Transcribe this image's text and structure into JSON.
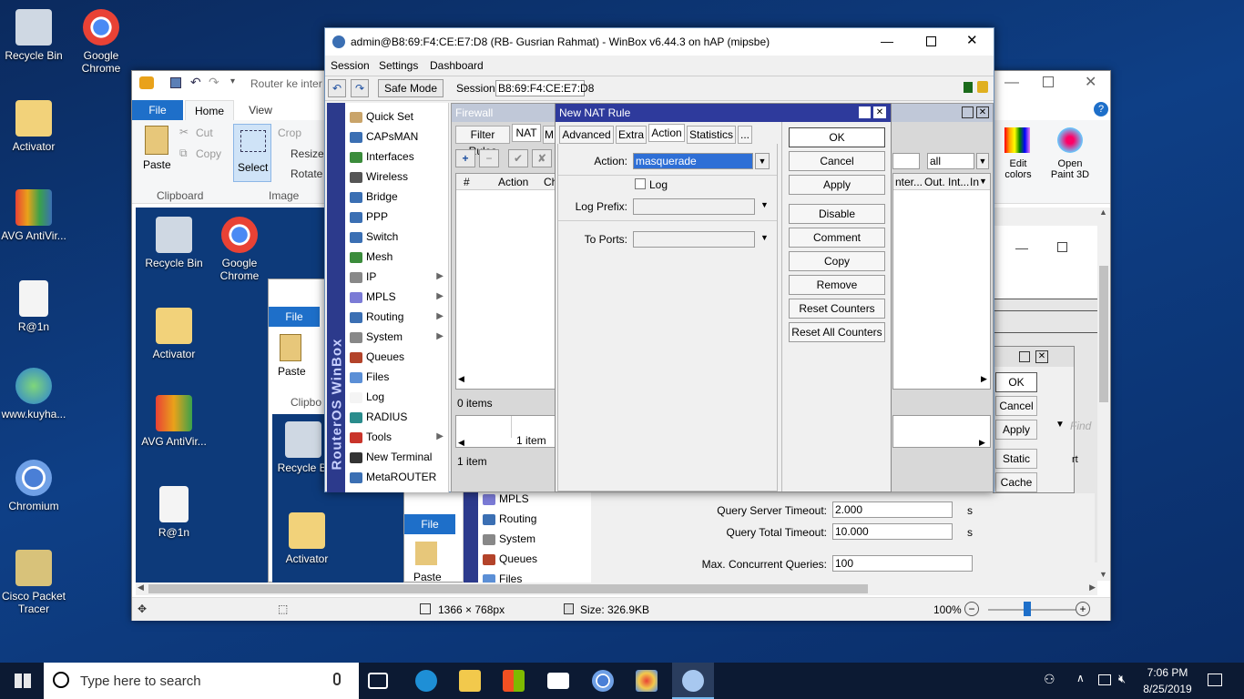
{
  "desktop": {
    "icons": [
      {
        "label": "Recycle Bin",
        "color": "#cfd8e3"
      },
      {
        "label": "Google Chrome",
        "color": "#e94235"
      },
      {
        "label": "Activator",
        "color": "#f2d27a"
      },
      {
        "label": "AVG AntiVir...",
        "color": "#e9a21a"
      },
      {
        "label": "R@1n",
        "color": "#f4f4f4"
      },
      {
        "label": "www.kuyha...",
        "color": "#3aa14b"
      },
      {
        "label": "Chromium",
        "color": "#4a7fd6"
      },
      {
        "label": "Cisco Packet Tracer",
        "color": "#d8c27a"
      }
    ]
  },
  "paint": {
    "title": "Router ke inter",
    "tabs": {
      "file": "File",
      "home": "Home",
      "view": "View"
    },
    "clipboard": {
      "paste": "Paste",
      "cut": "Cut",
      "copy": "Copy",
      "group": "Clipboard"
    },
    "image": {
      "select": "Select",
      "crop": "Crop",
      "resize": "Resize",
      "rotate": "Rotate",
      "group": "Image"
    },
    "right": {
      "edit_colors": "Edit colors",
      "open_paint3d": "Open Paint 3D"
    },
    "status": {
      "dimensions": "1366 × 768px",
      "size": "Size: 326.9KB",
      "zoom": "100%"
    }
  },
  "nested": {
    "recycle": "Recycle Bin",
    "chrome": "Google Chrome",
    "activator": "Activator",
    "avg": "AVG AntiVir...",
    "r1n": "R@1n",
    "file": "File",
    "paste": "Paste",
    "clipbo": "Clipbo",
    "recycle2": "Recycle Bi",
    "activator2": "Activator",
    "file2": "File",
    "paste2": "Paste"
  },
  "winbox": {
    "title": "admin@B8:69:F4:CE:E7:D8 (RB- Gusrian Rahmat) - WinBox v6.44.3 on hAP (mipsbe)",
    "menu": [
      "Session",
      "Settings",
      "Dashboard"
    ],
    "safe_mode": "Safe Mode",
    "session_label": "Session:",
    "session_value": "B8:69:F4:CE:E7:D8",
    "side_brand": "RouterOS WinBox",
    "side_items": [
      {
        "label": "Quick Set",
        "color": "#c9a46a",
        "arrow": ""
      },
      {
        "label": "CAPsMAN",
        "color": "#3b6fb3",
        "arrow": ""
      },
      {
        "label": "Interfaces",
        "color": "#3b8c3b",
        "arrow": ""
      },
      {
        "label": "Wireless",
        "color": "#555555",
        "arrow": ""
      },
      {
        "label": "Bridge",
        "color": "#3b6fb3",
        "arrow": ""
      },
      {
        "label": "PPP",
        "color": "#3b6fb3",
        "arrow": ""
      },
      {
        "label": "Switch",
        "color": "#3b6fb3",
        "arrow": ""
      },
      {
        "label": "Mesh",
        "color": "#3b8c3b",
        "arrow": ""
      },
      {
        "label": "IP",
        "color": "#888888",
        "arrow": "▶"
      },
      {
        "label": "MPLS",
        "color": "#7b7bd6",
        "arrow": "▶"
      },
      {
        "label": "Routing",
        "color": "#3b6fb3",
        "arrow": "▶"
      },
      {
        "label": "System",
        "color": "#888888",
        "arrow": "▶"
      },
      {
        "label": "Queues",
        "color": "#b3432a",
        "arrow": ""
      },
      {
        "label": "Files",
        "color": "#5b8fd6",
        "arrow": ""
      },
      {
        "label": "Log",
        "color": "#f4f4f4",
        "arrow": ""
      },
      {
        "label": "RADIUS",
        "color": "#2a8c8c",
        "arrow": ""
      },
      {
        "label": "Tools",
        "color": "#c9342a",
        "arrow": "▶"
      },
      {
        "label": "New Terminal",
        "color": "#333333",
        "arrow": ""
      },
      {
        "label": "MetaROUTER",
        "color": "#3b6fb3",
        "arrow": ""
      }
    ],
    "firewall": {
      "title": "Firewall",
      "tabs": [
        "Filter Rules",
        "NAT",
        "M"
      ],
      "col_hash": "#",
      "col_action": "Action",
      "col_ch": "Ch",
      "items": "0 items",
      "right_filter": "all",
      "col_inter": "nter...",
      "col_out": "Out. Int...",
      "col_in": "In"
    },
    "lower": {
      "item1": "1 item",
      "item2": "1 item"
    },
    "lower_nested": {
      "mpls": "MPLS",
      "routing": "Routing",
      "system": "System",
      "queues": "Queues",
      "files": "Files"
    }
  },
  "nat": {
    "title": "New NAT Rule",
    "tabs": [
      "Advanced",
      "Extra",
      "Action",
      "Statistics",
      "..."
    ],
    "action_label": "Action:",
    "action_value": "masquerade",
    "log_label": "Log",
    "log_prefix": "Log Prefix:",
    "to_ports": "To Ports:",
    "buttons": [
      "OK",
      "Cancel",
      "Apply",
      "Disable",
      "Comment",
      "Copy",
      "Remove",
      "Reset Counters",
      "Reset All Counters"
    ]
  },
  "bgdialog": {
    "ok": "OK",
    "cancel": "Cancel",
    "apply": "Apply",
    "static": "Static",
    "cache": "Cache",
    "find": "Find",
    "q_server": "Query Server Timeout:",
    "q_server_v": "2.000",
    "q_total": "Query Total Timeout:",
    "q_total_v": "10.000",
    "max_q": "Max. Concurrent Queries:",
    "max_q_v": "100",
    "s1": "s",
    "s2": "s",
    "rt": "rt"
  },
  "taskbar": {
    "search": "Type here to search",
    "time": "7:06 PM",
    "date": "8/25/2019"
  }
}
